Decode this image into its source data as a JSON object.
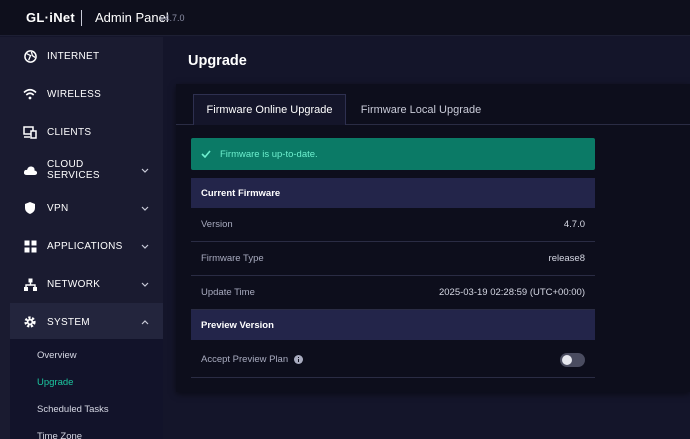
{
  "header": {
    "logo": "GL·iNet",
    "title": "Admin Panel",
    "version": "v4.7.0"
  },
  "sidebar": {
    "items": [
      {
        "label": "INTERNET",
        "icon": "globe-icon",
        "has_chevron": false
      },
      {
        "label": "WIRELESS",
        "icon": "wifi-icon",
        "has_chevron": false
      },
      {
        "label": "CLIENTS",
        "icon": "devices-icon",
        "has_chevron": false
      },
      {
        "label": "CLOUD SERVICES",
        "icon": "cloud-icon",
        "has_chevron": true
      },
      {
        "label": "VPN",
        "icon": "shield-icon",
        "has_chevron": true
      },
      {
        "label": "APPLICATIONS",
        "icon": "grid-icon",
        "has_chevron": true
      },
      {
        "label": "NETWORK",
        "icon": "network-icon",
        "has_chevron": true
      },
      {
        "label": "SYSTEM",
        "icon": "gear-icon",
        "has_chevron": true,
        "expanded": true
      }
    ],
    "system_submenu": [
      {
        "label": "Overview",
        "active": false
      },
      {
        "label": "Upgrade",
        "active": true
      },
      {
        "label": "Scheduled Tasks",
        "active": false
      },
      {
        "label": "Time Zone",
        "active": false
      }
    ]
  },
  "main": {
    "title": "Upgrade",
    "tabs": [
      {
        "label": "Firmware Online Upgrade",
        "active": true
      },
      {
        "label": "Firmware Local Upgrade",
        "active": false
      }
    ],
    "alert": "Firmware is up-to-date.",
    "current_firmware": {
      "heading": "Current Firmware",
      "rows": [
        {
          "label": "Version",
          "value": "4.7.0"
        },
        {
          "label": "Firmware Type",
          "value": "release8"
        },
        {
          "label": "Update Time",
          "value": "2025-03-19 02:28:59 (UTC+00:00)"
        }
      ]
    },
    "preview": {
      "heading": "Preview Version",
      "label": "Accept Preview Plan",
      "enabled": false
    }
  },
  "colors": {
    "accent": "#1cc7a0",
    "alert_bg": "#0b7a66",
    "sidebar_bg": "#1a1b30",
    "panel_bg": "#0d0e1c"
  }
}
